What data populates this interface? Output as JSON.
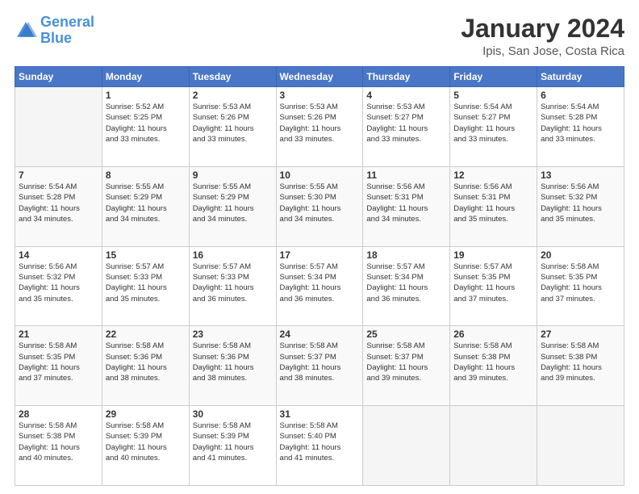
{
  "header": {
    "logo_line1": "General",
    "logo_line2": "Blue",
    "title": "January 2024",
    "subtitle": "Ipis, San Jose, Costa Rica"
  },
  "columns": [
    "Sunday",
    "Monday",
    "Tuesday",
    "Wednesday",
    "Thursday",
    "Friday",
    "Saturday"
  ],
  "weeks": [
    [
      {
        "day": "",
        "info": ""
      },
      {
        "day": "1",
        "info": "Sunrise: 5:52 AM\nSunset: 5:25 PM\nDaylight: 11 hours\nand 33 minutes."
      },
      {
        "day": "2",
        "info": "Sunrise: 5:53 AM\nSunset: 5:26 PM\nDaylight: 11 hours\nand 33 minutes."
      },
      {
        "day": "3",
        "info": "Sunrise: 5:53 AM\nSunset: 5:26 PM\nDaylight: 11 hours\nand 33 minutes."
      },
      {
        "day": "4",
        "info": "Sunrise: 5:53 AM\nSunset: 5:27 PM\nDaylight: 11 hours\nand 33 minutes."
      },
      {
        "day": "5",
        "info": "Sunrise: 5:54 AM\nSunset: 5:27 PM\nDaylight: 11 hours\nand 33 minutes."
      },
      {
        "day": "6",
        "info": "Sunrise: 5:54 AM\nSunset: 5:28 PM\nDaylight: 11 hours\nand 33 minutes."
      }
    ],
    [
      {
        "day": "7",
        "info": "Sunrise: 5:54 AM\nSunset: 5:28 PM\nDaylight: 11 hours\nand 34 minutes."
      },
      {
        "day": "8",
        "info": "Sunrise: 5:55 AM\nSunset: 5:29 PM\nDaylight: 11 hours\nand 34 minutes."
      },
      {
        "day": "9",
        "info": "Sunrise: 5:55 AM\nSunset: 5:29 PM\nDaylight: 11 hours\nand 34 minutes."
      },
      {
        "day": "10",
        "info": "Sunrise: 5:55 AM\nSunset: 5:30 PM\nDaylight: 11 hours\nand 34 minutes."
      },
      {
        "day": "11",
        "info": "Sunrise: 5:56 AM\nSunset: 5:31 PM\nDaylight: 11 hours\nand 34 minutes."
      },
      {
        "day": "12",
        "info": "Sunrise: 5:56 AM\nSunset: 5:31 PM\nDaylight: 11 hours\nand 35 minutes."
      },
      {
        "day": "13",
        "info": "Sunrise: 5:56 AM\nSunset: 5:32 PM\nDaylight: 11 hours\nand 35 minutes."
      }
    ],
    [
      {
        "day": "14",
        "info": "Sunrise: 5:56 AM\nSunset: 5:32 PM\nDaylight: 11 hours\nand 35 minutes."
      },
      {
        "day": "15",
        "info": "Sunrise: 5:57 AM\nSunset: 5:33 PM\nDaylight: 11 hours\nand 35 minutes."
      },
      {
        "day": "16",
        "info": "Sunrise: 5:57 AM\nSunset: 5:33 PM\nDaylight: 11 hours\nand 36 minutes."
      },
      {
        "day": "17",
        "info": "Sunrise: 5:57 AM\nSunset: 5:34 PM\nDaylight: 11 hours\nand 36 minutes."
      },
      {
        "day": "18",
        "info": "Sunrise: 5:57 AM\nSunset: 5:34 PM\nDaylight: 11 hours\nand 36 minutes."
      },
      {
        "day": "19",
        "info": "Sunrise: 5:57 AM\nSunset: 5:35 PM\nDaylight: 11 hours\nand 37 minutes."
      },
      {
        "day": "20",
        "info": "Sunrise: 5:58 AM\nSunset: 5:35 PM\nDaylight: 11 hours\nand 37 minutes."
      }
    ],
    [
      {
        "day": "21",
        "info": "Sunrise: 5:58 AM\nSunset: 5:35 PM\nDaylight: 11 hours\nand 37 minutes."
      },
      {
        "day": "22",
        "info": "Sunrise: 5:58 AM\nSunset: 5:36 PM\nDaylight: 11 hours\nand 38 minutes."
      },
      {
        "day": "23",
        "info": "Sunrise: 5:58 AM\nSunset: 5:36 PM\nDaylight: 11 hours\nand 38 minutes."
      },
      {
        "day": "24",
        "info": "Sunrise: 5:58 AM\nSunset: 5:37 PM\nDaylight: 11 hours\nand 38 minutes."
      },
      {
        "day": "25",
        "info": "Sunrise: 5:58 AM\nSunset: 5:37 PM\nDaylight: 11 hours\nand 39 minutes."
      },
      {
        "day": "26",
        "info": "Sunrise: 5:58 AM\nSunset: 5:38 PM\nDaylight: 11 hours\nand 39 minutes."
      },
      {
        "day": "27",
        "info": "Sunrise: 5:58 AM\nSunset: 5:38 PM\nDaylight: 11 hours\nand 39 minutes."
      }
    ],
    [
      {
        "day": "28",
        "info": "Sunrise: 5:58 AM\nSunset: 5:38 PM\nDaylight: 11 hours\nand 40 minutes."
      },
      {
        "day": "29",
        "info": "Sunrise: 5:58 AM\nSunset: 5:39 PM\nDaylight: 11 hours\nand 40 minutes."
      },
      {
        "day": "30",
        "info": "Sunrise: 5:58 AM\nSunset: 5:39 PM\nDaylight: 11 hours\nand 41 minutes."
      },
      {
        "day": "31",
        "info": "Sunrise: 5:58 AM\nSunset: 5:40 PM\nDaylight: 11 hours\nand 41 minutes."
      },
      {
        "day": "",
        "info": ""
      },
      {
        "day": "",
        "info": ""
      },
      {
        "day": "",
        "info": ""
      }
    ]
  ]
}
